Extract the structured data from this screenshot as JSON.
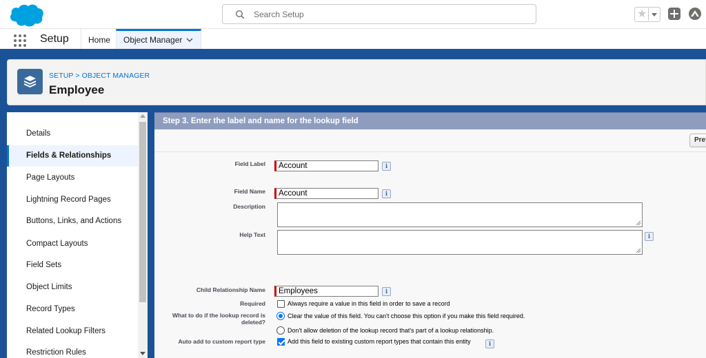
{
  "header": {
    "search_placeholder": "Search Setup",
    "brand_color": "#00a1e0"
  },
  "context_nav": {
    "app_name": "Setup",
    "tabs": [
      {
        "label": "Home"
      },
      {
        "label": "Object Manager",
        "active": true
      }
    ]
  },
  "page_header": {
    "breadcrumb": "SETUP > OBJECT MANAGER",
    "title": "Employee"
  },
  "sidebar": {
    "items": [
      {
        "label": "Details"
      },
      {
        "label": "Fields & Relationships",
        "active": true
      },
      {
        "label": "Page Layouts"
      },
      {
        "label": "Lightning Record Pages"
      },
      {
        "label": "Buttons, Links, and Actions"
      },
      {
        "label": "Compact Layouts"
      },
      {
        "label": "Field Sets"
      },
      {
        "label": "Object Limits"
      },
      {
        "label": "Record Types"
      },
      {
        "label": "Related Lookup Filters"
      },
      {
        "label": "Restriction Rules"
      }
    ]
  },
  "form": {
    "step_title": "Step 3. Enter the label and name for the lookup field",
    "prev_button": "Previous",
    "field_label": {
      "label": "Field Label",
      "value": "Account"
    },
    "field_name": {
      "label": "Field Name",
      "value": "Account"
    },
    "description": {
      "label": "Description",
      "value": ""
    },
    "help_text": {
      "label": "Help Text",
      "value": ""
    },
    "child_relationship": {
      "label": "Child Relationship Name",
      "value": "Employees"
    },
    "required": {
      "label": "Required",
      "option": "Always require a value in this field in order to save a record",
      "checked": false
    },
    "on_delete": {
      "label": "What to do if the lookup record is deleted?",
      "options": [
        {
          "text": "Clear the value of this field. You can't choose this option if you make this field required.",
          "selected": true
        },
        {
          "text": "Don't allow deletion of the lookup record that's part of a lookup relationship.",
          "selected": false
        }
      ]
    },
    "auto_add": {
      "label": "Auto add to custom report type",
      "option": "Add this field to existing custom report types that contain this entity",
      "checked": true
    },
    "info_glyph": "i"
  }
}
